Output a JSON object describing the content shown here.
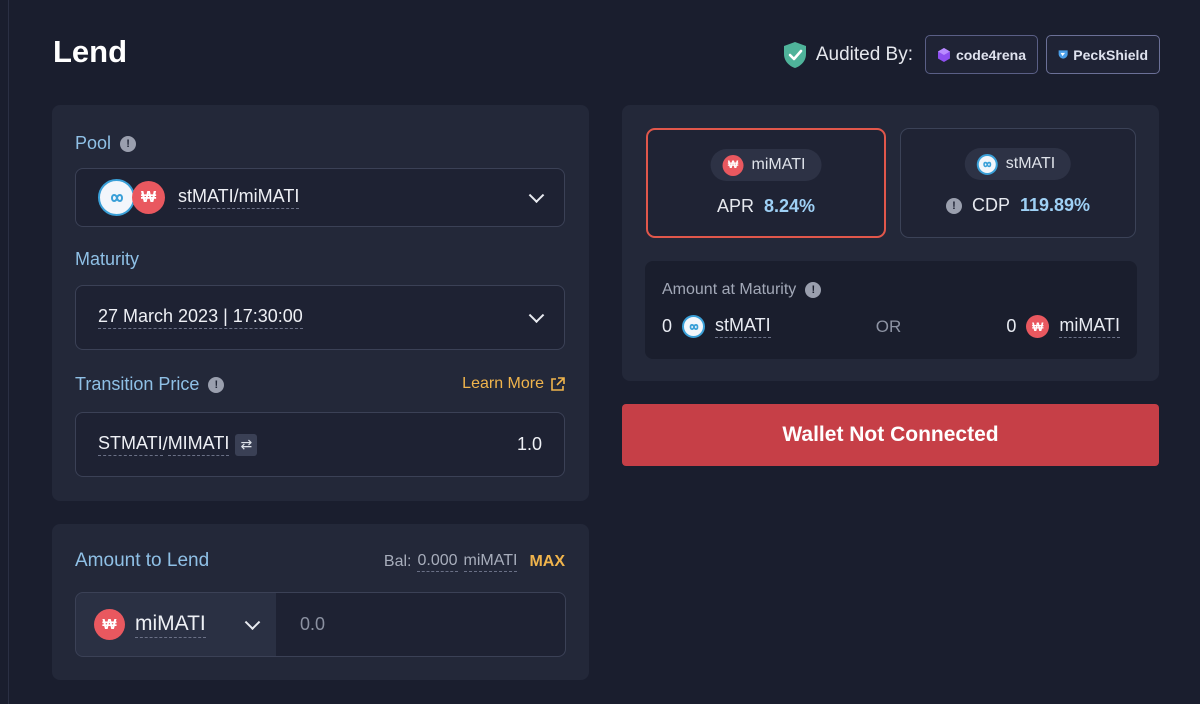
{
  "page": {
    "title": "Lend"
  },
  "audit": {
    "label": "Audited By:",
    "auditors": [
      "code4rena",
      "PeckShield"
    ]
  },
  "pool": {
    "label": "Pool",
    "value": "stMATI/miMATI",
    "tokens": [
      {
        "name": "stMATI",
        "icon": "stmati-token-icon"
      },
      {
        "name": "miMATI",
        "icon": "mimati-token-icon"
      }
    ]
  },
  "maturity": {
    "label": "Maturity",
    "value": "27 March 2023 | 17:30:00"
  },
  "transition": {
    "label": "Transition Price",
    "learn_more": "Learn More",
    "pair_left": "STMATI",
    "pair_sep": "/",
    "pair_right": "MIMATI",
    "value": "1.0"
  },
  "stats": {
    "apr": {
      "token": "miMATI",
      "label": "APR",
      "value": "8.24%"
    },
    "cdp": {
      "token": "stMATI",
      "label": "CDP",
      "value": "119.89%"
    }
  },
  "maturity_amount": {
    "label": "Amount at Maturity",
    "left_value": "0",
    "left_token": "stMATI",
    "or": "OR",
    "right_value": "0",
    "right_token": "miMATI"
  },
  "wallet_button": "Wallet Not Connected",
  "amount": {
    "label": "Amount to Lend",
    "balance_prefix": "Bal:",
    "balance_value": "0.000",
    "balance_token": "miMATI",
    "max": "MAX",
    "token": "miMATI",
    "placeholder": "0.0"
  },
  "colors": {
    "background": "#1a1e2e",
    "card": "#232839",
    "label_blue": "#8fc0e6",
    "accent_orange": "#f0b44c",
    "danger_red": "#c63f47",
    "value_blue": "#9ed0f5"
  }
}
